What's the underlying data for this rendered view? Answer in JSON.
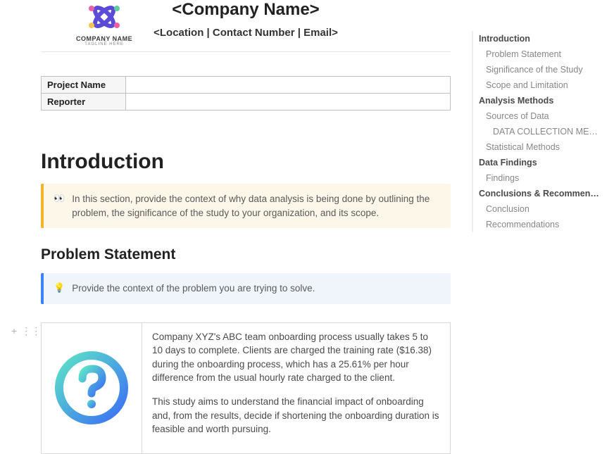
{
  "header": {
    "logo_text": "COMPANY NAME",
    "logo_sub": "TAGLINE HERE",
    "company_name": "<Company Name>",
    "meta": "<Location | Contact Number | Email>"
  },
  "info_table": {
    "rows": [
      {
        "label": "Project Name",
        "value": ""
      },
      {
        "label": "Reporter",
        "value": ""
      }
    ]
  },
  "sections": {
    "introduction": {
      "title": "Introduction",
      "callout_icon": "👀",
      "callout_text": "In this section, provide the context of why data analysis is being done by outlining the problem, the significance of the study to your organization, and its scope."
    },
    "problem_statement": {
      "title": "Problem Statement",
      "callout_icon": "💡",
      "callout_text": "Provide the context of the problem you are trying to solve.",
      "body_p1": "Company XYZ's ABC team onboarding process usually takes 5 to 10 days to complete. Clients are charged the training rate ($16.38) during the onboarding process, which has a 25.61% per hour difference from the usual hourly rate charged to the client.",
      "body_p2": "This study aims to understand the financial impact of onboarding and, from the results, decide if shortening the onboarding duration is feasible and worth pursuing."
    }
  },
  "toc": [
    {
      "level": "h1",
      "label": "Introduction"
    },
    {
      "level": "h2",
      "label": "Problem Statement"
    },
    {
      "level": "h2",
      "label": "Significance of the Study"
    },
    {
      "level": "h2",
      "label": "Scope and Limitation"
    },
    {
      "level": "h1",
      "label": "Analysis Methods"
    },
    {
      "level": "h2",
      "label": "Sources of Data"
    },
    {
      "level": "h3",
      "label": "DATA COLLECTION METHOD"
    },
    {
      "level": "h2",
      "label": "Statistical Methods"
    },
    {
      "level": "h1",
      "label": "Data Findings"
    },
    {
      "level": "h2",
      "label": "Findings"
    },
    {
      "level": "h1",
      "label": "Conclusions & Recommendations"
    },
    {
      "level": "h2",
      "label": "Conclusion"
    },
    {
      "level": "h2",
      "label": "Recommendations"
    }
  ],
  "icons": {
    "add": "+",
    "drag": "⋮⋮"
  }
}
